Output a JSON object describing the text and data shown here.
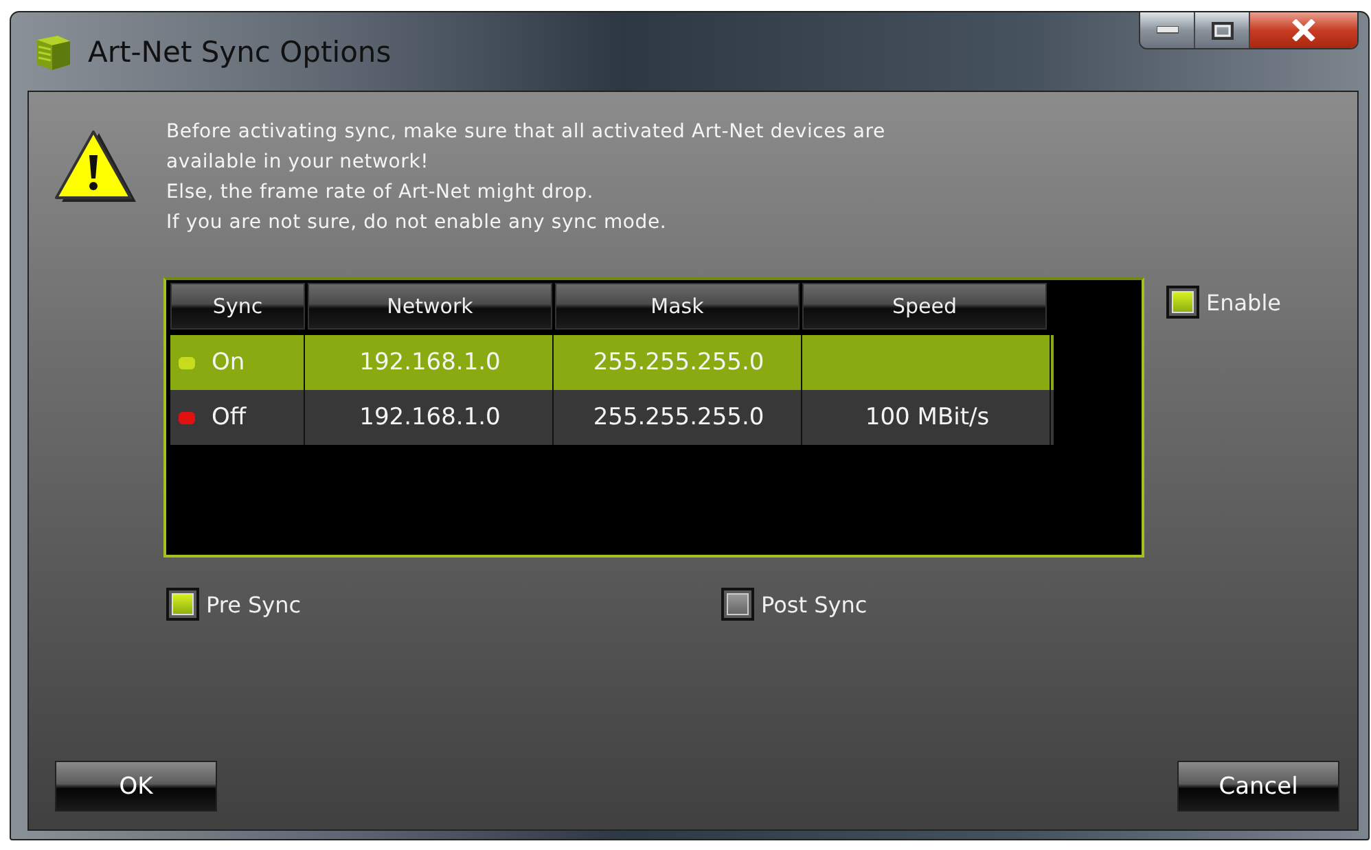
{
  "window": {
    "title": "Art-Net Sync Options"
  },
  "warning": {
    "lines": [
      "Before activating sync, make sure that all activated Art-Net devices are",
      "available in your network!",
      "Else, the frame rate of Art-Net might drop.",
      "If you are not sure, do not enable any sync mode."
    ]
  },
  "table": {
    "columns": [
      "Sync",
      "Network",
      "Mask",
      "Speed"
    ],
    "rows": [
      {
        "sync": "On",
        "color": "#c8dc1e",
        "network": "192.168.1.0",
        "mask": "255.255.255.0",
        "speed": "",
        "selected": true
      },
      {
        "sync": "Off",
        "color": "#e01010",
        "network": "192.168.1.0",
        "mask": "255.255.255.0",
        "speed": "100 MBit/s",
        "selected": false
      }
    ]
  },
  "enable": {
    "label": "Enable",
    "checked": true
  },
  "options": [
    {
      "label": "Pre Sync",
      "checked": true
    },
    {
      "label": "Post Sync",
      "checked": false
    }
  ],
  "buttons": {
    "ok": "OK",
    "cancel": "Cancel"
  }
}
